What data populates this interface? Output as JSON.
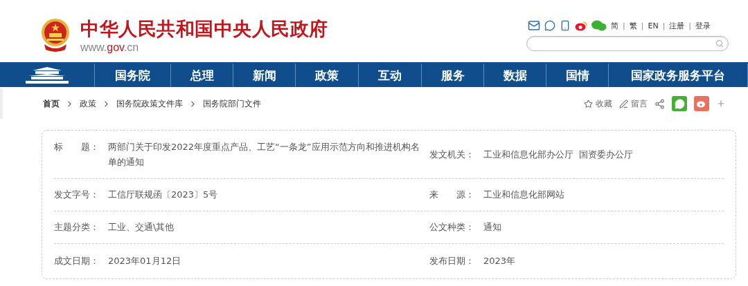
{
  "header": {
    "title": "中华人民共和国中央人民政府",
    "url": [
      "www.",
      "gov",
      ".cn"
    ],
    "top_links": [
      "简",
      "繁",
      "EN",
      "注册",
      "登录"
    ],
    "link_separator": "|"
  },
  "nav": {
    "items": [
      "国务院",
      "总理",
      "新闻",
      "政策",
      "互动",
      "服务",
      "数据",
      "国情",
      "国家政务服务平台"
    ]
  },
  "breadcrumb": {
    "items": [
      "首页",
      "政策",
      "国务院政策文件库",
      "国务院部门文件"
    ],
    "actions": [
      {
        "kind": "favorite",
        "label": "收藏"
      },
      {
        "kind": "comment",
        "label": "留言"
      },
      {
        "kind": "share"
      },
      {
        "kind": "wechat"
      },
      {
        "kind": "weibo"
      },
      {
        "kind": "more"
      }
    ]
  },
  "document_info": {
    "rows": [
      [
        {
          "label": "标　　题：",
          "value": "两部门关于印发2022年度重点产品、工艺“一条龙”应用示范方向和推进机构名单的通知"
        },
        {
          "label": "发文机关：",
          "value": "工业和信息化部办公厅  国资委办公厅"
        }
      ],
      [
        {
          "label": "发文字号：",
          "value": "工信厅联规函〔2023〕5号"
        },
        {
          "label": "来　　源：",
          "value": "工业和信息化部网站"
        }
      ],
      [
        {
          "label": "主题分类：",
          "value": "工业、交通\\其他"
        },
        {
          "label": "公文种类：",
          "value": "通知"
        }
      ],
      [
        {
          "label": "成文日期：",
          "value": "2023年01月12日"
        },
        {
          "label": "发布日期：",
          "value": "2023年"
        }
      ]
    ]
  }
}
